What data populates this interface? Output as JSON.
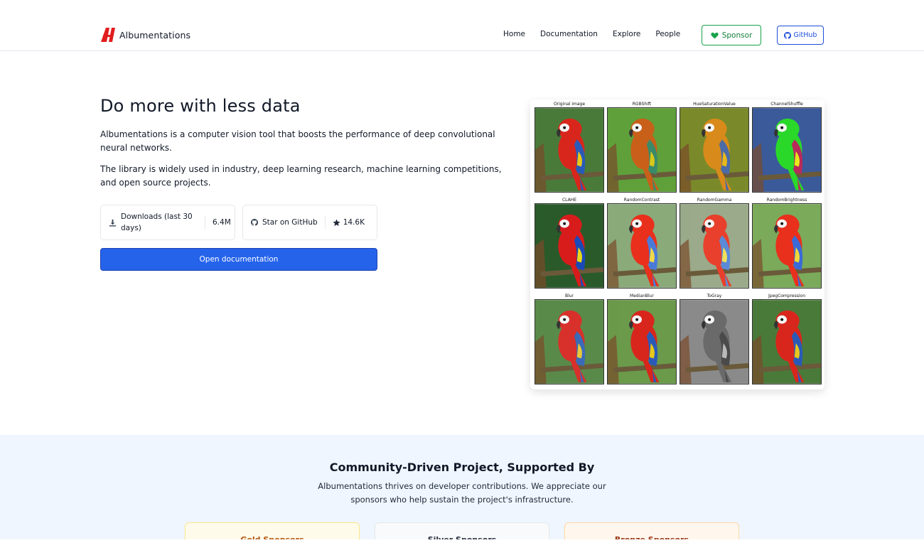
{
  "header": {
    "brand": "Albumentations",
    "nav": [
      "Home",
      "Documentation",
      "Explore",
      "People"
    ],
    "sponsor_label": "Sponsor",
    "github_label": "GitHub"
  },
  "hero": {
    "title": "Do more with less data",
    "paragraph1": "Albumentations is a computer vision tool that boosts the performance of deep convolutional neural networks.",
    "paragraph2": "The library is widely used in industry, deep learning research, machine learning competitions, and open source projects.",
    "downloads_label": "Downloads (last 30 days)",
    "downloads_value": "6.4M",
    "github_star_label": "Star on GitHub",
    "github_stars": "14.6K",
    "open_docs_label": "Open documentation"
  },
  "augmentations": [
    {
      "label": "Original image",
      "colors": {
        "bg": "#4a7a3a",
        "bird": "#d9261c",
        "wing": "#2a5ab8",
        "yellow": "#e8c81a"
      }
    },
    {
      "label": "RGBShift",
      "colors": {
        "bg": "#5fa03a",
        "bird": "#c8601a",
        "wing": "#3a8a6a",
        "yellow": "#d8c81a"
      }
    },
    {
      "label": "HueSaturationValue",
      "colors": {
        "bg": "#7a8a2a",
        "bird": "#d88a1a",
        "wing": "#4a6aa8",
        "yellow": "#e8b81a"
      }
    },
    {
      "label": "ChannelShuffle",
      "colors": {
        "bg": "#3a5a9a",
        "bird": "#2ad82a",
        "wing": "#b82a5a",
        "yellow": "#e8e81a"
      }
    },
    {
      "label": "CLAHE",
      "colors": {
        "bg": "#2a5a2a",
        "bird": "#d81c1c",
        "wing": "#1a4ab8",
        "yellow": "#e8d81a"
      }
    },
    {
      "label": "RandomContrast",
      "colors": {
        "bg": "#8aaa7a",
        "bird": "#e8301c",
        "wing": "#4a7ad8",
        "yellow": "#f0d84a"
      }
    },
    {
      "label": "RandomGamma",
      "colors": {
        "bg": "#9aaa8a",
        "bird": "#e8402c",
        "wing": "#5a8ad8",
        "yellow": "#f0e05a"
      }
    },
    {
      "label": "RandomBrightness",
      "colors": {
        "bg": "#7aaa5a",
        "bird": "#e8301c",
        "wing": "#3a6ad8",
        "yellow": "#f0d83a"
      }
    },
    {
      "label": "Blur",
      "colors": {
        "bg": "#5a8a4a",
        "bird": "#d8302a",
        "wing": "#3a6ab8",
        "yellow": "#e8c83a"
      }
    },
    {
      "label": "MedianBlur",
      "colors": {
        "bg": "#6a9a4a",
        "bird": "#d8261c",
        "wing": "#2a5ab8",
        "yellow": "#e8c81a"
      }
    },
    {
      "label": "ToGray",
      "colors": {
        "bg": "#8a8a8a",
        "bird": "#6a6a6a",
        "wing": "#4a4a4a",
        "yellow": "#bababa"
      }
    },
    {
      "label": "JpegCompression",
      "colors": {
        "bg": "#4a7a3a",
        "bird": "#d9261c",
        "wing": "#2a5ab8",
        "yellow": "#e8c81a"
      }
    }
  ],
  "community": {
    "title": "Community-Driven Project, Supported By",
    "description": "Albumentations thrives on developer contributions. We appreciate our sponsors who help sustain the project's infrastructure.",
    "tiers": [
      "Gold Sponsors",
      "Silver Sponsors",
      "Bronze Sponsors"
    ]
  },
  "colors": {
    "accent": "#2563eb",
    "sponsor_green": "#16a34a",
    "logo_red": "#e11d1d"
  }
}
